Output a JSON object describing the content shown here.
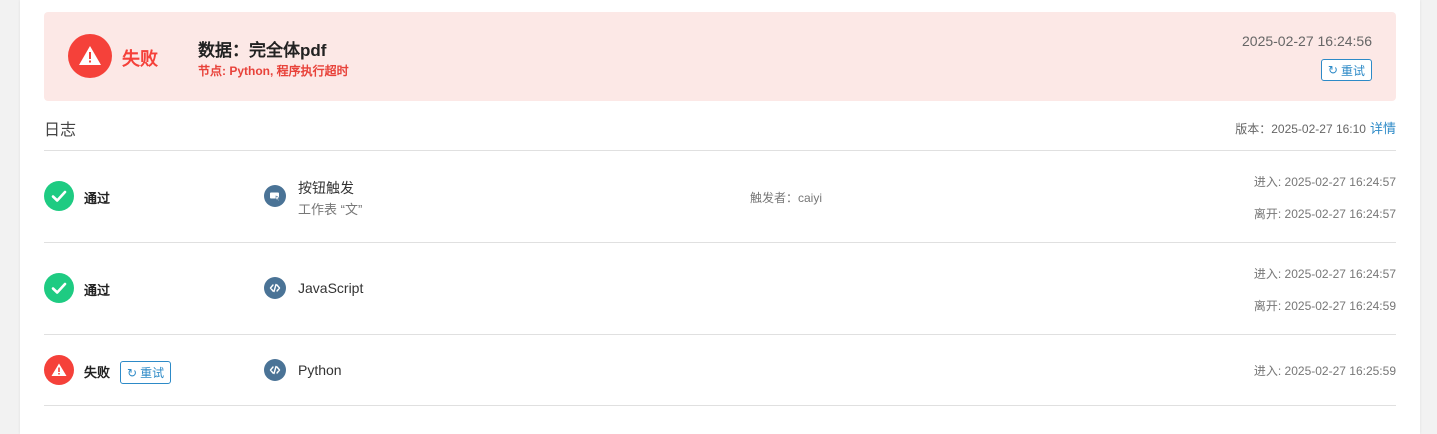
{
  "banner": {
    "status": "失败",
    "title": "数据：完全体pdf",
    "subtitle": "节点: Python, 程序执行超时",
    "timestamp": "2025-02-27 16:24:56",
    "retry_label": "重试"
  },
  "log": {
    "title": "日志",
    "version_text": "版本：2025-02-27 16:10",
    "details_label": "详情"
  },
  "rows": [
    {
      "status": "通过",
      "node_name": "按钮触发",
      "node_sub": "工作表 “文”",
      "trigger_text": "触发者：caiyi",
      "enter": "进入: 2025-02-27 16:24:57",
      "leave": "离开: 2025-02-27 16:24:57"
    },
    {
      "status": "通过",
      "node_name": "JavaScript",
      "enter": "进入: 2025-02-27 16:24:57",
      "leave": "离开: 2025-02-27 16:24:59"
    },
    {
      "status": "失败",
      "retry_label": "重试",
      "node_name": "Python",
      "enter": "进入: 2025-02-27 16:25:59"
    }
  ],
  "colors": {
    "fail": "#f5413a",
    "pass": "#1ecb82",
    "accent": "#2d8ac7",
    "node": "#4a7396",
    "banner_bg": "#fce8e6"
  },
  "icons": {
    "banner": "warning-icon",
    "pass": "check-icon",
    "fail": "warning-icon",
    "button_trigger": "button-trigger-icon",
    "code": "code-icon",
    "retry": "refresh-icon"
  }
}
